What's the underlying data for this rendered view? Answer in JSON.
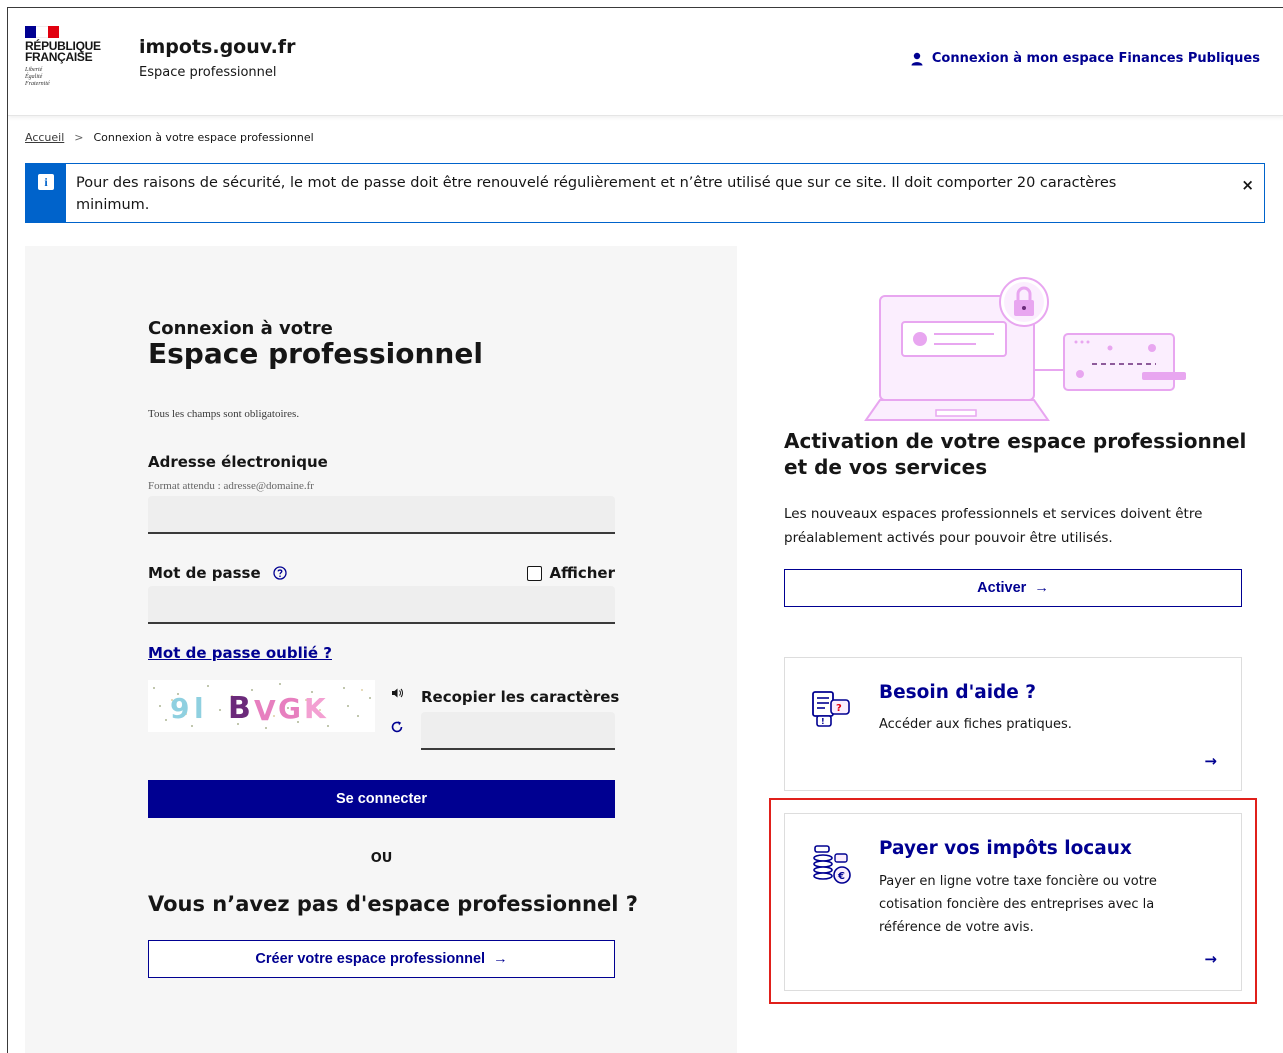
{
  "header": {
    "logo_title_line1": "RÉPUBLIQUE",
    "logo_title_line2": "FRANÇAISE",
    "motto_line1": "Liberté",
    "motto_line2": "Égalité",
    "motto_line3": "Fraternité",
    "site_title": "impots.gouv.fr",
    "site_subtitle": "Espace professionnel",
    "login_link": "Connexion à mon espace Finances Publiques",
    "login_icon": "user-icon"
  },
  "breadcrumb": {
    "home": "Accueil",
    "separator": ">",
    "current": "Connexion à votre espace professionnel"
  },
  "notice": {
    "text": "Pour des raisons de sécurité, le mot de passe doit être renouvelé régulièrement et n’être utilisé que sur ce site. Il doit comporter 20 caractères minimum.",
    "icon_glyph": "i",
    "close": "×"
  },
  "login": {
    "title_small": "Connexion à votre",
    "title_big": "Espace professionnel",
    "required_note": "Tous les champs sont obligatoires.",
    "email_label": "Adresse électronique",
    "email_hint": "Format attendu : adresse@domaine.fr",
    "email_value": "",
    "password_label": "Mot de passe",
    "password_value": "",
    "show_label": "Afficher",
    "show_checked": false,
    "forgot": "Mot de passe oublié ?",
    "captcha_text": "9l BVGK",
    "captcha_label": "Recopier les caractères",
    "captcha_value": "",
    "submit": "Se connecter",
    "or": "OU",
    "no_space": "Vous n’avez pas d'espace professionnel ?",
    "create": "Créer votre espace professionnel",
    "arrow": "→"
  },
  "activation": {
    "title": "Activation de votre espace professionnel et de vos services",
    "desc": "Les nouveaux espaces professionnels et services doivent être préalablement activés pour pouvoir être utilisés.",
    "button": "Activer",
    "arrow": "→"
  },
  "cards": [
    {
      "title": "Besoin d'aide ?",
      "desc": "Accéder aux fiches pratiques.",
      "icon": "help-chat-icon",
      "arrow": "→"
    },
    {
      "title": "Payer vos impôts locaux",
      "desc": "Payer en ligne votre taxe foncière ou votre cotisation foncière des entreprises avec la référence de votre avis.",
      "icon": "coins-payment-icon",
      "arrow": "→"
    }
  ],
  "colors": {
    "primary_blue": "#000091",
    "info_blue": "#0063cb",
    "highlight_red": "#e0201b",
    "panel_grey": "#f6f6f6",
    "illustration_pink": "#e8a6f0"
  }
}
